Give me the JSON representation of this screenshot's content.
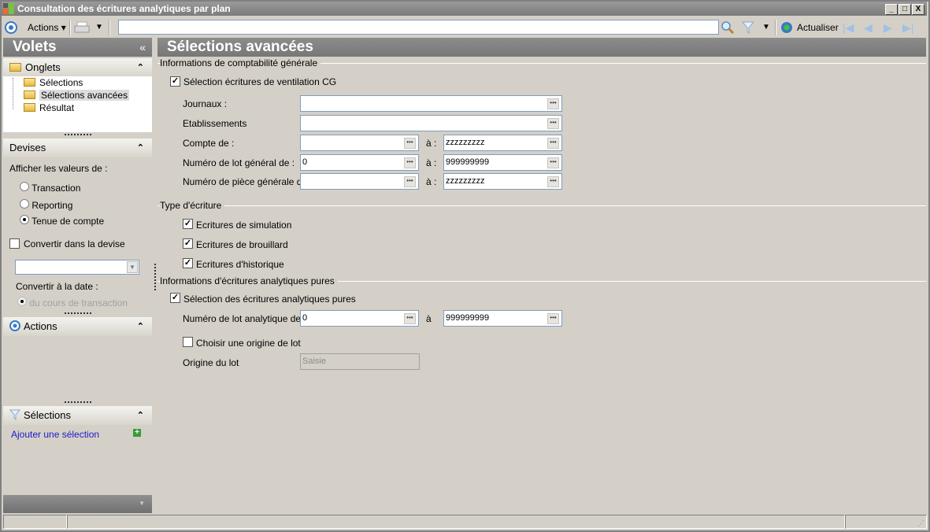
{
  "window": {
    "title": "Consultation des écritures analytiques par plan",
    "minimize": "_",
    "maximize": "□",
    "close": "X"
  },
  "toolbar": {
    "actions_label": "Actions",
    "search_value": "",
    "refresh_label": "Actualiser"
  },
  "left": {
    "title": "Volets",
    "collapse": "«",
    "onglets": {
      "title": "Onglets",
      "items": [
        {
          "label": "Sélections"
        },
        {
          "label": "Sélections avancées",
          "selected": true
        },
        {
          "label": "Résultat"
        }
      ]
    },
    "devises": {
      "title": "Devises",
      "afficher_label": "Afficher les valeurs de :",
      "options": [
        {
          "label": "Transaction",
          "checked": false
        },
        {
          "label": "Reporting",
          "checked": false
        },
        {
          "label": "Tenue de compte",
          "checked": true
        }
      ],
      "convertir_label": "Convertir dans la devise",
      "convertir_checked": false,
      "devise_value": "",
      "date_label": "Convertir à la date :",
      "date_option": "du cours de transaction"
    },
    "actions": {
      "title": "Actions"
    },
    "selections": {
      "title": "Sélections",
      "add_link": "Ajouter une sélection"
    }
  },
  "main": {
    "title": "Sélections avancées",
    "cg": {
      "group": "Informations de comptabilité générale",
      "check_label": "Sélection écritures de ventilation CG",
      "checked": true,
      "journaux_label": "Journaux :",
      "journaux_value": "",
      "etab_label": "Etablissements",
      "etab_value": "",
      "compte_label": "Compte de :",
      "compte_from": "",
      "compte_to": "zzzzzzzzz",
      "lot_label": "Numéro de lot général de :",
      "lot_from": "0",
      "lot_to": "999999999",
      "piece_label": "Numéro de pièce générale de :",
      "piece_from": "",
      "piece_to": "zzzzzzzzz",
      "to_label": "à :"
    },
    "type": {
      "group": "Type d'écriture",
      "items": [
        {
          "label": "Ecritures de simulation",
          "checked": true
        },
        {
          "label": "Ecritures de brouillard",
          "checked": true
        },
        {
          "label": "Ecritures d'historique",
          "checked": true
        }
      ]
    },
    "ana": {
      "group": "Informations d'écritures analytiques pures",
      "check_label": "Sélection des écritures analytiques pures",
      "checked": true,
      "lot_label": "Numéro de lot analytique de  :",
      "lot_from": "0",
      "to_label": "à",
      "lot_to": "999999999",
      "origine_check": "Choisir une origine de lot",
      "origine_checked": false,
      "origine_label": "Origine du lot",
      "origine_value": "Saisie"
    }
  }
}
